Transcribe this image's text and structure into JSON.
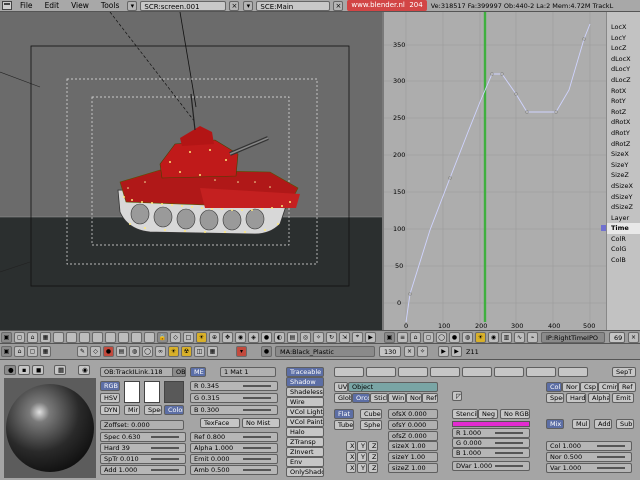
{
  "topbar": {
    "menus": [
      "File",
      "Edit",
      "View",
      "Tools"
    ],
    "screen": "SCR:screen.001",
    "scene": "SCE:Main",
    "url": "www.blender.nl",
    "frame": "204",
    "stats": "Ve:318517 Fa:399997  Ob:440-2 La:2  Mem:4.72M   TrackL"
  },
  "ipo": {
    "y_ticks": [
      "350",
      "300",
      "250",
      "200",
      "150",
      "100",
      "50",
      "0"
    ],
    "x_ticks": [
      "0",
      "100",
      "200",
      "300",
      "400",
      "500"
    ],
    "channels": [
      "LocX",
      "LocY",
      "LocZ",
      "dLocX",
      "dLocY",
      "dLocZ",
      "RotX",
      "RotY",
      "RotZ",
      "dRotX",
      "dRotY",
      "dRotZ",
      "SizeX",
      "SizeY",
      "SizeZ",
      "dSizeX",
      "dSizeY",
      "dSizeZ",
      "Layer",
      "Time",
      "ColR",
      "ColG",
      "ColB"
    ],
    "selected_channel": "Time",
    "header_label": "IP:RightTimeIPO",
    "header_num": "69"
  },
  "header2": {
    "material": "MA:Black_Plastic",
    "mat_count": "130",
    "frame_label": "Z11"
  },
  "material": {
    "object_label": "OB:TrackILink.118",
    "ob_btn": "OB",
    "me_btn": "ME",
    "mode_btns": [
      "RGB",
      "HSV",
      "DYN"
    ],
    "mir_spec_color": [
      "Mir",
      "Spec",
      "Color"
    ],
    "sliders_rgb": [
      "R 0.345",
      "G 0.315",
      "B 0.300"
    ],
    "one_mat": "1 Mat 1",
    "texface": "TexFace",
    "nomist": "No Mist",
    "zoffset": "Zoffset: 0.000",
    "left_sliders": [
      "Spec 0.630",
      "Hard 39",
      "SpTr 0.010",
      "Add 1.000"
    ],
    "mid_sliders": [
      "Ref 0.800",
      "Alpha 1.000",
      "Emit 0.000",
      "Amb 0.500"
    ],
    "toggles": [
      "Traceable",
      "Shadow",
      "Shadeless",
      "Wire",
      "VCol Light",
      "VCol Paint",
      "Halo",
      "ZTransp",
      "ZInvert",
      "Env",
      "OnlyShadow"
    ],
    "uv_object": [
      "UV",
      "Object"
    ],
    "map_row": [
      "Glob",
      "Orco",
      "Stick",
      "Win",
      "Nor",
      "Refl"
    ],
    "flat_cube": [
      "Flat",
      "Cube"
    ],
    "tube_sphe": [
      "Tube",
      "Sphe"
    ],
    "ofs": [
      "ofsX 0.000",
      "ofsY 0.000",
      "ofsZ 0.000"
    ],
    "size": [
      "sizeX 1.00",
      "sizeY 1.00",
      "sizeZ 1.00"
    ],
    "stencil_row": [
      "Stencil",
      "Neg",
      "No RGB"
    ],
    "tex_rgb": [
      "R 1.000",
      "G 0.000",
      "B 1.000"
    ],
    "dvar": "DVar 1.000",
    "right_row1": [
      "Col",
      "Nor",
      "Csp",
      "Cmir",
      "Ref"
    ],
    "right_row2": [
      "Spec",
      "Hard",
      "Alpha",
      "Emit"
    ],
    "blend_row": [
      "Mix",
      "Mul",
      "Add",
      "Sub"
    ],
    "right_sliders": [
      "Col 1.000",
      "Nor 0.500",
      "Var 1.000"
    ],
    "sept": "SepT",
    "colors": {
      "magenta": "#e22bd0",
      "selected_blue": "#5c6ea5",
      "tank_red": "#b01818"
    }
  },
  "icons": {
    "viewport_header": [
      "cube-icon",
      "grid-icon",
      "wire-icon",
      "solid-icon",
      "shaded-icon"
    ]
  }
}
